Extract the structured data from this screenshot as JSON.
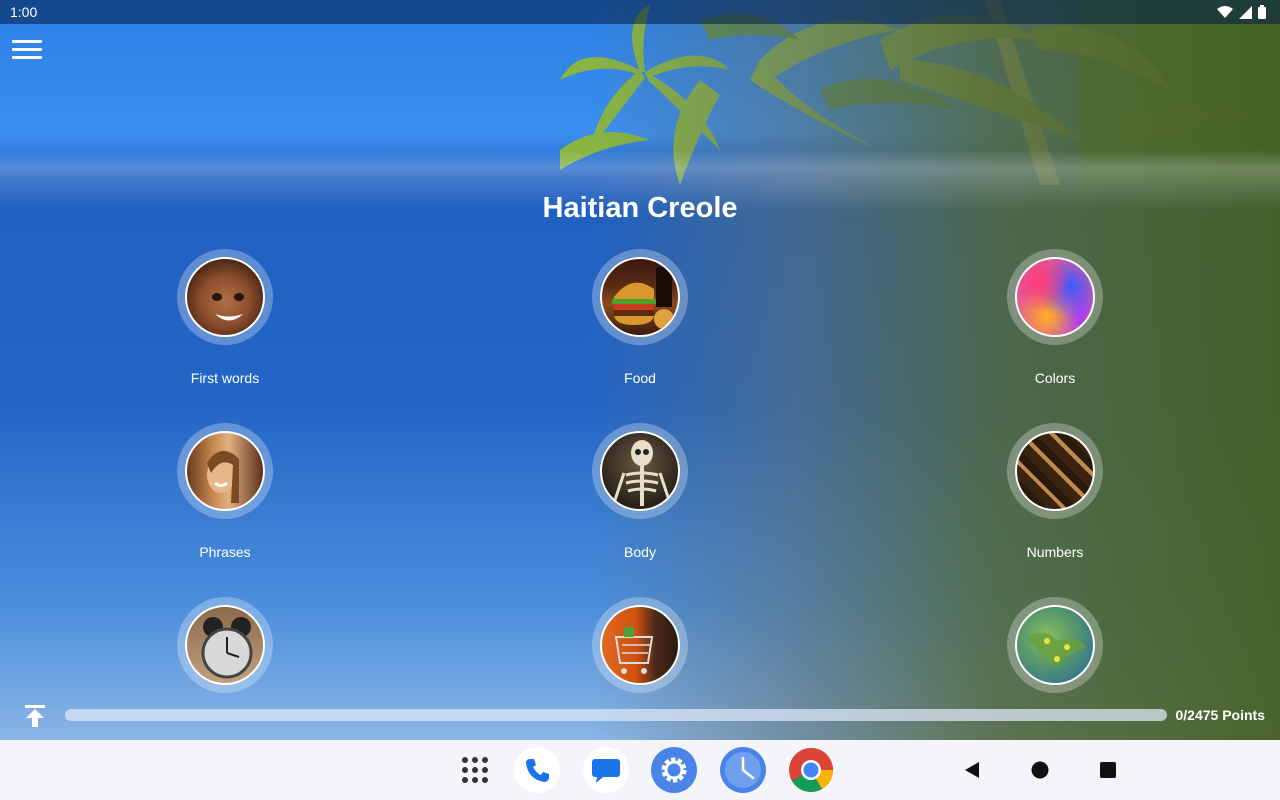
{
  "status": {
    "time": "1:00"
  },
  "title": "Haitian Creole",
  "categories": [
    {
      "label": "First words",
      "icon": "child-face-photo"
    },
    {
      "label": "Food",
      "icon": "burger-photo"
    },
    {
      "label": "Colors",
      "icon": "color-powder-photo"
    },
    {
      "label": "Phrases",
      "icon": "smiling-woman-photo"
    },
    {
      "label": "Body",
      "icon": "skeleton-photo"
    },
    {
      "label": "Numbers",
      "icon": "number-blocks-photo"
    },
    {
      "label": "",
      "icon": "alarm-clock-photo"
    },
    {
      "label": "",
      "icon": "shopping-cart-photo"
    },
    {
      "label": "",
      "icon": "world-map-photo"
    }
  ],
  "progress": {
    "value": 0,
    "text": "0/2475 Points"
  },
  "dock": [
    "apps-grid-icon",
    "phone-icon",
    "messages-icon",
    "settings-icon",
    "clock-icon",
    "chrome-icon"
  ],
  "nav": [
    "back-icon",
    "home-icon",
    "recents-icon"
  ],
  "colors": {
    "accent_blue": "#2466c6",
    "dock_blue": "#4a84e8"
  }
}
